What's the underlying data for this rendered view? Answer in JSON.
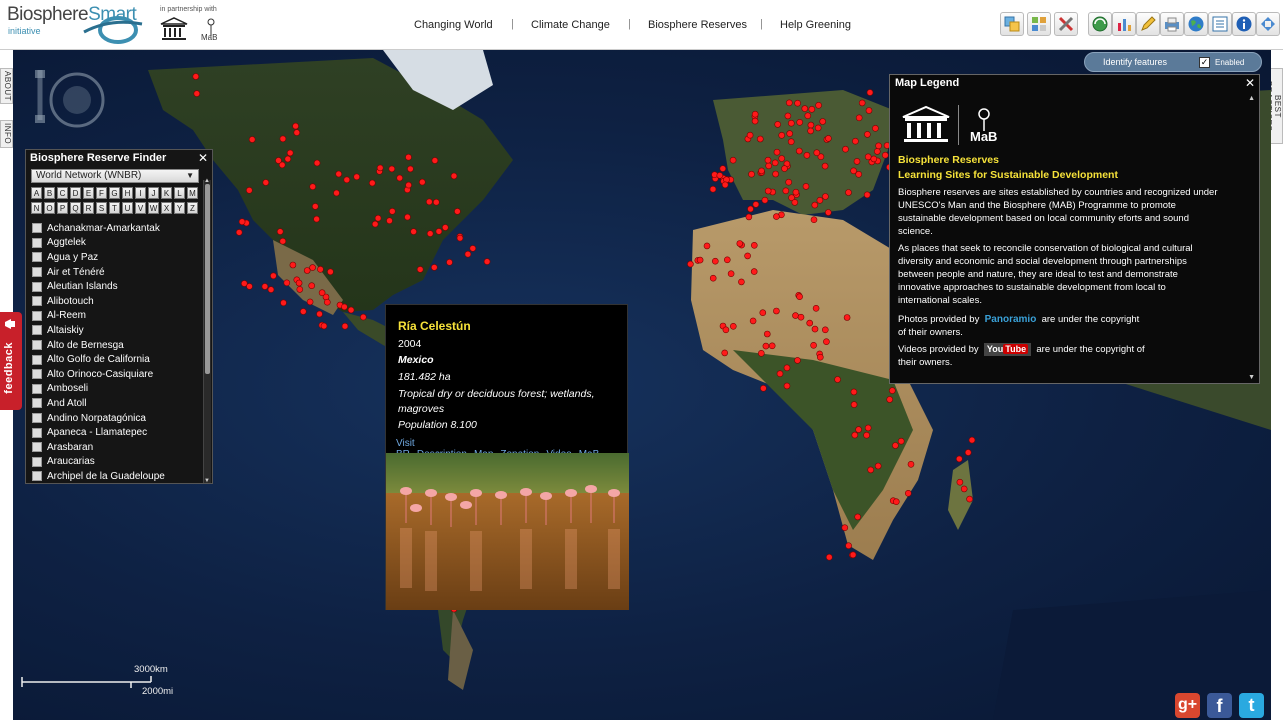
{
  "header": {
    "brand_main": "Biosphere",
    "brand_smart": "Smart",
    "brand_sub": "initiative",
    "partner_text": "in partnership with",
    "partner_logos": [
      "unesco-logo",
      "mab-logo"
    ],
    "nav": [
      "Changing World",
      "Climate Change",
      "Biosphere Reserves",
      "Help Greening"
    ],
    "nav_separator": "|",
    "toolbar_icons": [
      "search-icon",
      "layers-grid-icon",
      "tools-icon",
      "globe-refresh-icon",
      "chart-icon",
      "draw-icon",
      "print-icon",
      "world-icon",
      "list-icon",
      "info-icon",
      "fullscreen-icon"
    ]
  },
  "side_tabs": {
    "about": "ABOUT",
    "info": "INFO",
    "best_practices": "BEST PRACTICES",
    "feedback": "feedback"
  },
  "identify": {
    "label": "Identify features",
    "checked": true,
    "check_mark": "✓",
    "enabled_label": "Enabled"
  },
  "finder": {
    "title": "Biosphere Reserve Finder",
    "close": "✕",
    "dropdown_value": "World Network (WNBR)",
    "dropdown_arrow": "▼",
    "letters_row1": [
      "A",
      "B",
      "C",
      "D",
      "E",
      "F",
      "G",
      "H",
      "I",
      "J",
      "K",
      "L",
      "M"
    ],
    "letters_row2": [
      "N",
      "O",
      "P",
      "Q",
      "R",
      "S",
      "T",
      "U",
      "V",
      "W",
      "X",
      "Y",
      "Z"
    ],
    "items": [
      "Achanakmar-Amarkantak",
      "Aggtelek",
      "Agua y Paz",
      "Air et Ténéré",
      "Aleutian Islands",
      "Alibotouch",
      "Al-Reem",
      "Altaiskiy",
      "Alto de Bernesga",
      "Alto Golfo de California",
      "Alto Orinoco-Casiquiare",
      "Amboseli",
      "And Atoll",
      "Andino Norpatagónica",
      "Apaneca - Llamatepec",
      "Arasbaran",
      "Araucarias",
      "Archipel de la Guadeloupe"
    ]
  },
  "popup": {
    "name": "Ría Celestún",
    "year": "2004",
    "country": "Mexico",
    "area": "181.482 ha",
    "ecosystem_line1": "Tropical dry or deciduous forest; wetlands,",
    "ecosystem_line2": "magroves",
    "population": "Population 8.100",
    "links": [
      "Visit BR",
      "Description",
      "Map",
      "Zonation",
      "Video",
      "MaB"
    ]
  },
  "legend": {
    "title": "Map Legend",
    "close": "✕",
    "heading1": "Biosphere Reserves",
    "heading2": "Learning Sites for Sustainable Development",
    "para1_lines": [
      "Biosphere reserves are sites established by countries and recognized under",
      "UNESCO's Man and the Biosphere (MAB) Programme to promote",
      "sustainable development based on local community eforts and sound",
      "science."
    ],
    "para2_lines": [
      "As places that seek to reconcile conservation of biological and cultural",
      "diversity and economic and social development through partnerships",
      "between people and nature, they are ideal to test and demonstrate",
      "innovative approaches to sustainable development from local to",
      "international scales."
    ],
    "photos_prefix": "Photos provided by",
    "panoramio_brand": "Panoramio",
    "photos_suffix": "are under the copyright",
    "photos_suffix2": "of their owners.",
    "videos_prefix": "Videos provided by",
    "youtube_you": "You",
    "youtube_tube": "Tube",
    "videos_suffix": "are under the copyright of",
    "videos_suffix2": "their owners.",
    "mab_text": "MaB"
  },
  "scale": {
    "km": "3000km",
    "mi": "2000mi"
  },
  "social": {
    "google_plus": "g+",
    "facebook": "f",
    "twitter": "t"
  },
  "colors": {
    "marker": "#ff1a1a",
    "popup_title": "#f6e23a",
    "link": "#6fa8e0",
    "ocean": "#0e2143"
  }
}
